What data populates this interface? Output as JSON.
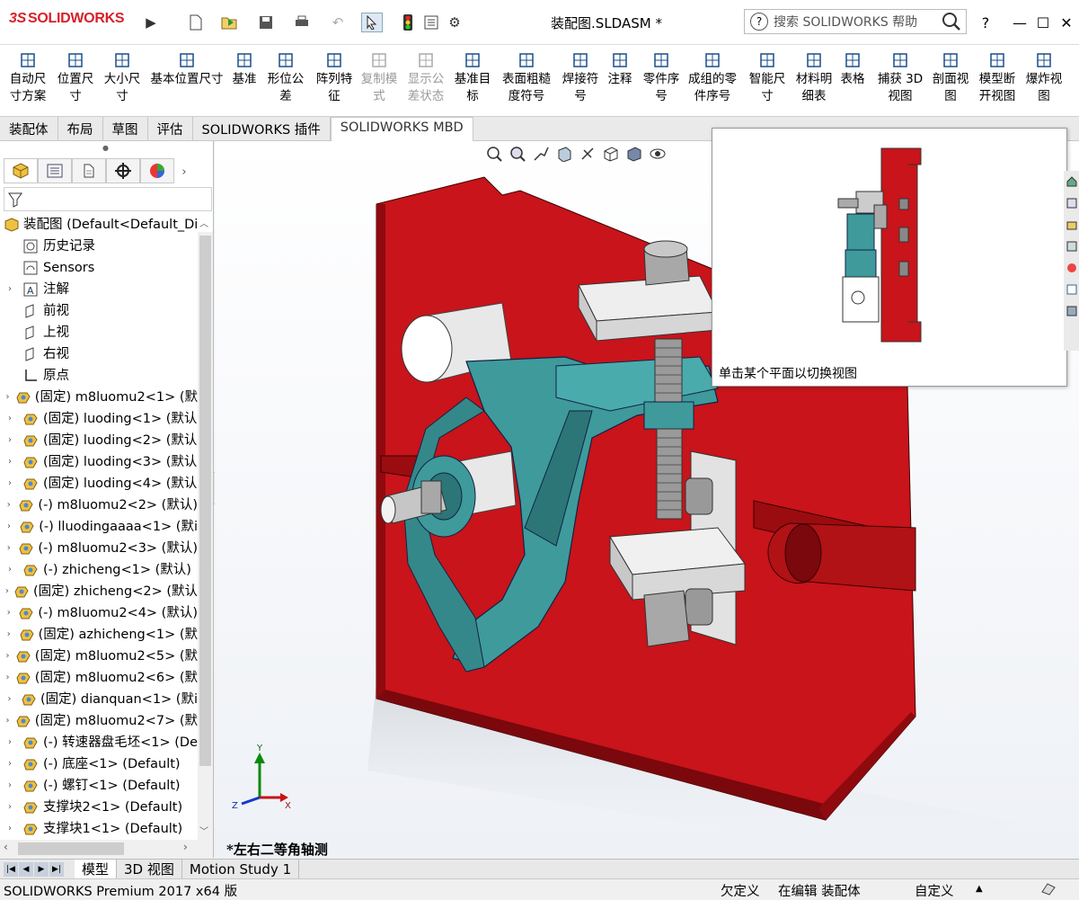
{
  "app": {
    "logo_text": "SOLIDWORKS",
    "doc_title": "装配图.SLDASM *"
  },
  "search": {
    "placeholder": "搜索 SOLIDWORKS 帮助"
  },
  "title_controls": {
    "help": "?",
    "minimize": "—",
    "maximize": "☐",
    "close": "✕"
  },
  "ribbon": {
    "buttons": [
      {
        "label": "自动尺\n寸方案",
        "icon": "auto-dimension-icon",
        "enabled": true
      },
      {
        "label": "位置尺\n寸",
        "icon": "location-dimension-icon",
        "enabled": true
      },
      {
        "label": "大小尺\n寸",
        "icon": "size-dimension-icon",
        "enabled": true
      },
      {
        "label": "基本位置尺寸",
        "icon": "basic-location-dimension-icon",
        "enabled": true
      },
      {
        "label": "基准",
        "icon": "datum-icon",
        "enabled": true
      },
      {
        "label": "形位公\n差",
        "icon": "geometric-tolerance-icon",
        "enabled": true
      },
      {
        "label": "阵列特\n征",
        "icon": "pattern-feature-icon",
        "enabled": true
      },
      {
        "label": "复制模\n式",
        "icon": "copy-scheme-icon",
        "enabled": false
      },
      {
        "label": "显示公\n差状态",
        "icon": "show-tolerance-status-icon",
        "enabled": false
      },
      {
        "label": "基准目\n标",
        "icon": "datum-target-icon",
        "enabled": true
      },
      {
        "label": "表面粗糙\n度符号",
        "icon": "surface-finish-icon",
        "enabled": true
      },
      {
        "label": "焊接符\n号",
        "icon": "weld-symbol-icon",
        "enabled": true
      },
      {
        "label": "注释",
        "icon": "note-icon",
        "enabled": true
      },
      {
        "label": "零件序\n号",
        "icon": "balloon-icon",
        "enabled": true
      },
      {
        "label": "成组的零\n件序号",
        "icon": "stacked-balloon-icon",
        "enabled": true
      },
      {
        "label": "智能尺\n寸",
        "icon": "smart-dimension-icon",
        "enabled": true
      },
      {
        "label": "材料明\n细表",
        "icon": "bom-icon",
        "enabled": true
      },
      {
        "label": "表格",
        "icon": "table-icon",
        "enabled": true
      },
      {
        "label": "捕获 3D\n视图",
        "icon": "capture-3d-view-icon",
        "enabled": true
      },
      {
        "label": "剖面视\n图",
        "icon": "section-view-icon",
        "enabled": true
      },
      {
        "label": "模型断\n开视图",
        "icon": "model-break-view-icon",
        "enabled": true
      },
      {
        "label": "爆炸视\n图",
        "icon": "explode-view-icon",
        "enabled": true
      }
    ]
  },
  "tabs": [
    "装配体",
    "布局",
    "草图",
    "评估",
    "SOLIDWORKS 插件",
    "SOLIDWORKS MBD"
  ],
  "active_tab": "SOLIDWORKS MBD",
  "tree": {
    "items": [
      {
        "label": "装配图  (Default<Default_Di",
        "icon": "assembly-icon",
        "expand": "",
        "indent": 0
      },
      {
        "label": "历史记录",
        "icon": "history-icon",
        "expand": "",
        "indent": 1
      },
      {
        "label": "Sensors",
        "icon": "sensors-icon",
        "expand": "",
        "indent": 1
      },
      {
        "label": "注解",
        "icon": "annotations-icon",
        "expand": "›",
        "indent": 1
      },
      {
        "label": "前视",
        "icon": "plane-icon",
        "expand": "",
        "indent": 1
      },
      {
        "label": "上视",
        "icon": "plane-icon",
        "expand": "",
        "indent": 1
      },
      {
        "label": "右视",
        "icon": "plane-icon",
        "expand": "",
        "indent": 1
      },
      {
        "label": "原点",
        "icon": "origin-icon",
        "expand": "",
        "indent": 1
      },
      {
        "label": "(固定) m8luomu2<1> (默",
        "icon": "part-icon",
        "expand": "›",
        "indent": 1
      },
      {
        "label": "(固定) luoding<1> (默认",
        "icon": "part-icon",
        "expand": "›",
        "indent": 1
      },
      {
        "label": "(固定) luoding<2> (默认",
        "icon": "part-icon",
        "expand": "›",
        "indent": 1
      },
      {
        "label": "(固定) luoding<3> (默认",
        "icon": "part-icon",
        "expand": "›",
        "indent": 1
      },
      {
        "label": "(固定) luoding<4> (默认",
        "icon": "part-icon",
        "expand": "›",
        "indent": 1
      },
      {
        "label": "(-) m8luomu2<2> (默认)",
        "icon": "part-icon",
        "expand": "›",
        "indent": 1
      },
      {
        "label": "(-) lluodingaaaa<1> (默i",
        "icon": "part-icon",
        "expand": "›",
        "indent": 1
      },
      {
        "label": "(-) m8luomu2<3> (默认)",
        "icon": "part-icon",
        "expand": "›",
        "indent": 1
      },
      {
        "label": "(-) zhicheng<1> (默认)",
        "icon": "part-icon",
        "expand": "›",
        "indent": 1
      },
      {
        "label": "(固定) zhicheng<2> (默认",
        "icon": "part-icon",
        "expand": "›",
        "indent": 1
      },
      {
        "label": "(-) m8luomu2<4> (默认)",
        "icon": "part-icon",
        "expand": "›",
        "indent": 1
      },
      {
        "label": "(固定) azhicheng<1> (默",
        "icon": "part-icon",
        "expand": "›",
        "indent": 1
      },
      {
        "label": "(固定) m8luomu2<5> (默",
        "icon": "part-icon",
        "expand": "›",
        "indent": 1
      },
      {
        "label": "(固定) m8luomu2<6> (默",
        "icon": "part-icon",
        "expand": "›",
        "indent": 1
      },
      {
        "label": "(固定) dianquan<1> (默i",
        "icon": "part-icon",
        "expand": "›",
        "indent": 1
      },
      {
        "label": "(固定) m8luomu2<7> (默",
        "icon": "part-icon",
        "expand": "›",
        "indent": 1
      },
      {
        "label": "(-) 转速器盘毛坯<1> (De",
        "icon": "part-icon",
        "expand": "›",
        "indent": 1
      },
      {
        "label": "(-) 底座<1> (Default)",
        "icon": "part-icon",
        "expand": "›",
        "indent": 1
      },
      {
        "label": "(-) 螺钉<1> (Default)",
        "icon": "part-icon",
        "expand": "›",
        "indent": 1
      },
      {
        "label": "支撑块2<1> (Default)",
        "icon": "part-icon",
        "expand": "›",
        "indent": 1
      },
      {
        "label": "支撑块1<1> (Default)",
        "icon": "part-icon",
        "expand": "›",
        "indent": 1
      }
    ]
  },
  "viewport": {
    "view_name": "*左右二等角轴测",
    "popup_caption": "单击某个平面以切换视图",
    "colors": {
      "base_plate": "#c8141a",
      "bracket": "#3f9a9c",
      "clamp": "#dcdcdc",
      "bolt": "#a8a8a8"
    }
  },
  "bottom_tabs": [
    "模型",
    "3D 视图",
    "Motion Study 1"
  ],
  "active_bottom_tab": "模型",
  "status": {
    "product": "SOLIDWORKS Premium 2017 x64 版",
    "definition": "欠定义",
    "mode": "在编辑 装配体",
    "units": "自定义"
  }
}
